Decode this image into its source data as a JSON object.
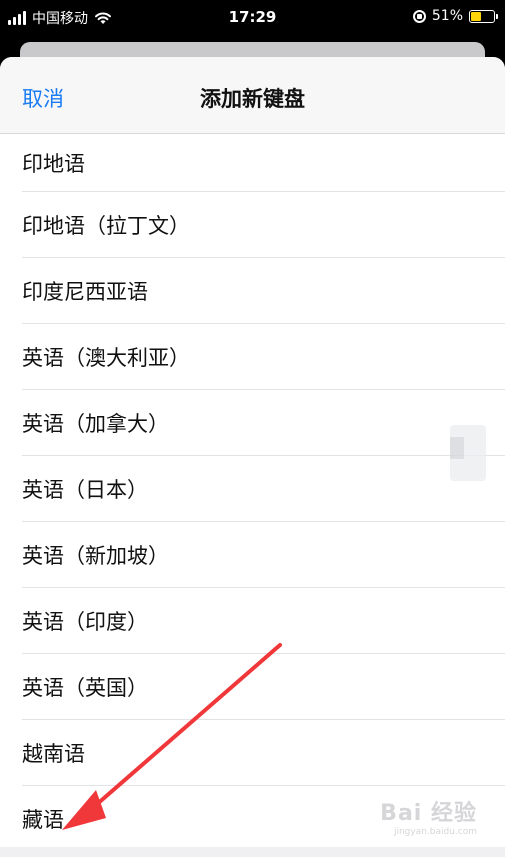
{
  "status_bar": {
    "carrier": "中国移动",
    "time": "17:29",
    "battery_percent": "51%",
    "battery_level": 0.51,
    "battery_color": "#ffd60a"
  },
  "nav": {
    "cancel_label": "取消",
    "title": "添加新键盘"
  },
  "keyboards": [
    "印地语",
    "印地语（拉丁文）",
    "印度尼西亚语",
    "英语（澳大利亚）",
    "英语（加拿大）",
    "英语（日本）",
    "英语（新加坡）",
    "英语（印度）",
    "英语（英国）",
    "越南语",
    "藏语"
  ],
  "colors": {
    "accent": "#1a7cf2",
    "annotation_arrow": "#f0373a"
  },
  "watermark": {
    "text": "Bai 经验",
    "sub": "jingyan.baidu.com"
  }
}
